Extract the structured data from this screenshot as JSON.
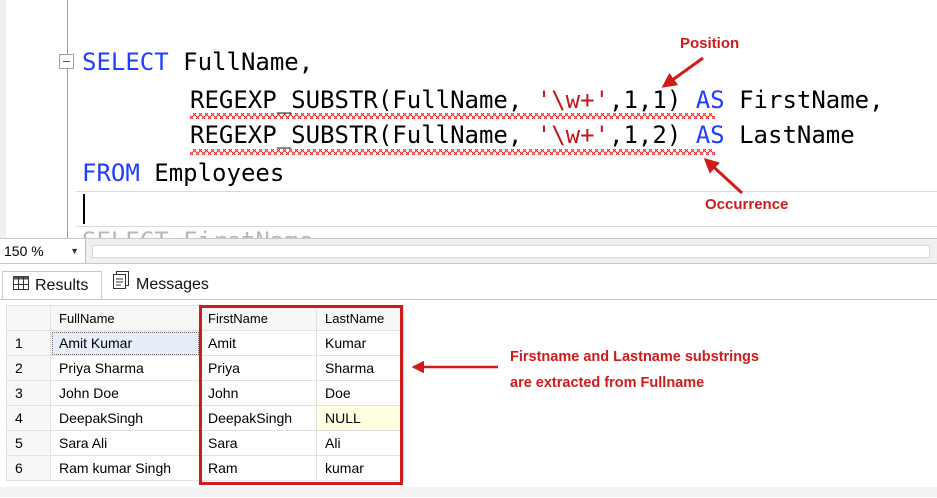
{
  "editor": {
    "lines": [
      {
        "parts": [
          {
            "t": "SELECT",
            "c": "kw"
          },
          {
            "t": " FullName,",
            "c": ""
          }
        ]
      },
      {
        "parts": [
          {
            "t": "REGEXP_SUBSTR(FullName, ",
            "c": ""
          },
          {
            "t": "'\\w+'",
            "c": "str"
          },
          {
            "t": ",1,1) ",
            "c": ""
          },
          {
            "t": "AS",
            "c": "kw"
          },
          {
            "t": " FirstName,",
            "c": ""
          }
        ]
      },
      {
        "parts": [
          {
            "t": "REGEXP_SUBSTR(FullName, ",
            "c": ""
          },
          {
            "t": "'\\w+'",
            "c": "str"
          },
          {
            "t": ",1,2) ",
            "c": ""
          },
          {
            "t": "AS",
            "c": "kw"
          },
          {
            "t": " LastName",
            "c": ""
          }
        ]
      },
      {
        "parts": [
          {
            "t": "FROM",
            "c": "kw"
          },
          {
            "t": " Employees",
            "c": ""
          }
        ]
      }
    ]
  },
  "annotations": {
    "position": "Position",
    "occurrence": "Occurrence",
    "note_line1": "Firstname and Lastname substrings",
    "note_line2": "are extracted from Fullname"
  },
  "status": {
    "zoom": "150 %"
  },
  "tabs": {
    "results": "Results",
    "messages": "Messages"
  },
  "grid": {
    "columns": [
      "FullName",
      "FirstName",
      "LastName"
    ],
    "rows": [
      {
        "n": "1",
        "full": "Amit Kumar",
        "first": "Amit",
        "last": "Kumar"
      },
      {
        "n": "2",
        "full": "Priya Sharma",
        "first": "Priya",
        "last": "Sharma"
      },
      {
        "n": "3",
        "full": "John  Doe",
        "first": "John",
        "last": "Doe"
      },
      {
        "n": "4",
        "full": "DeepakSingh",
        "first": "DeepakSingh",
        "last": "NULL"
      },
      {
        "n": "5",
        "full": "Sara Ali",
        "first": "Sara",
        "last": "Ali"
      },
      {
        "n": "6",
        "full": "Ram kumar  Singh",
        "first": "Ram",
        "last": "kumar"
      }
    ]
  },
  "colors": {
    "keyword": "#1f3fff",
    "string": "#c4161c",
    "annotation": "#d11a1a",
    "null_cell": "#ffffe1"
  },
  "icons": {
    "results_tab": "grid-icon",
    "messages_tab": "document-icon",
    "zoom_dropdown": "chevron-down-icon"
  }
}
